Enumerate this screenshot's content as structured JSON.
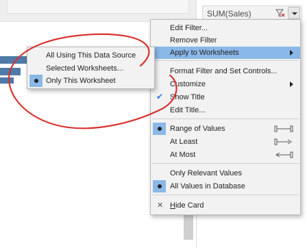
{
  "filter_card": {
    "title": "SUM(Sales)"
  },
  "main_menu": {
    "items": [
      {
        "label": "Edit Filter..."
      },
      {
        "label": "Remove Filter"
      },
      {
        "label": "Apply to Worksheets"
      },
      {
        "label": "Format Filter and Set Controls..."
      },
      {
        "label": "Customize"
      },
      {
        "label": "Show Title"
      },
      {
        "label": "Edit Title..."
      },
      {
        "label": "Range of Values"
      },
      {
        "label": "At Least"
      },
      {
        "label": "At Most"
      },
      {
        "label": "Only Relevant Values"
      },
      {
        "label": "All Values in Database"
      },
      {
        "label_hotkey": "H",
        "label_rest": "ide Card"
      }
    ]
  },
  "sub_menu": {
    "items": [
      {
        "label": "All Using This Data Source"
      },
      {
        "label": "Selected Worksheets..."
      },
      {
        "label": "Only This Worksheet"
      }
    ]
  },
  "colors": {
    "highlight": "#8ab8e8",
    "annotation": "#d9322f",
    "bar": "#4f79a6"
  }
}
